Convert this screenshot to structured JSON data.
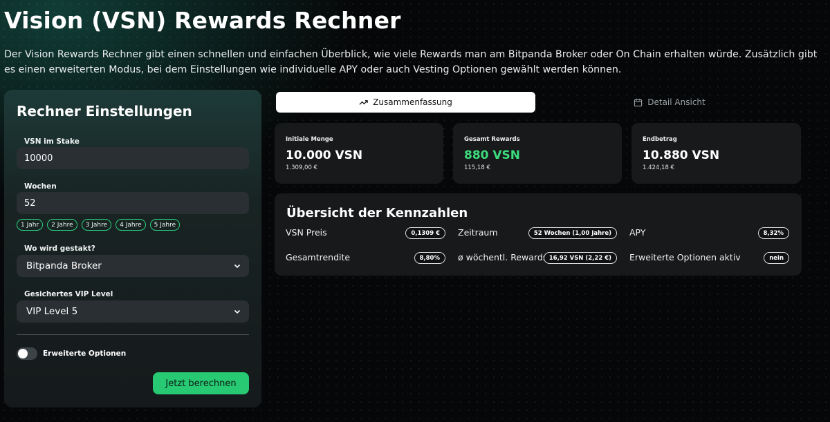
{
  "page": {
    "title": "Vision (VSN) Rewards Rechner",
    "description": "Der Vision Rewards Rechner gibt einen schnellen und einfachen Überblick, wie viele Rewards man am Bitpanda Broker oder On Chain erhalten würde. Zusätzlich gibt es einen erweiterten Modus, bei dem Einstellungen wie individuelle APY oder auch Vesting Optionen gewählt werden können."
  },
  "settings": {
    "title": "Rechner Einstellungen",
    "stake_label": "VSN im Stake",
    "stake_value": "10000",
    "weeks_label": "Wochen",
    "weeks_value": "52",
    "week_chips": [
      "1 Jahr",
      "2 Jahre",
      "3 Jahre",
      "4 Jahre",
      "5 Jahre"
    ],
    "location_label": "Wo wird gestakt?",
    "location_value": "Bitpanda Broker",
    "vip_label": "Gesichertes VIP Level",
    "vip_value": "VIP Level 5",
    "advanced_label": "Erweiterte Optionen",
    "calc_button": "Jetzt berechnen"
  },
  "tabs": {
    "summary": "Zusammenfassung",
    "detail": "Detail Ansicht"
  },
  "stats": {
    "initial": {
      "label": "Initiale Menge",
      "value": "10.000 VSN",
      "sub": "1.309,00 €"
    },
    "rewards": {
      "label": "Gesamt Rewards",
      "value": "880 VSN",
      "sub": "115,18 €"
    },
    "final": {
      "label": "Endbetrag",
      "value": "10.880 VSN",
      "sub": "1.424,18 €"
    }
  },
  "overview": {
    "title": "Übersicht der Kennzahlen",
    "metrics": [
      {
        "label": "VSN Preis",
        "value": "0,1309 €"
      },
      {
        "label": "Zeitraum",
        "value": "52 Wochen (1,00 Jahre)"
      },
      {
        "label": "APY",
        "value": "8,32%"
      },
      {
        "label": "Gesamtrendite",
        "value": "8,80%"
      },
      {
        "label": "ø wöchentl. Rewards",
        "value": "16,92 VSN (2,22 €)"
      },
      {
        "label": "Erweiterte Optionen aktiv",
        "value": "nein"
      }
    ]
  },
  "colors": {
    "accent_green": "#27c973",
    "rewards_green": "#3ddc7c",
    "panel_bg": "#17191b",
    "page_bg": "#060708"
  },
  "icons": {
    "summary_tab": "trending-up-icon",
    "detail_tab": "calendar-icon",
    "select": "chevron-down-icon"
  }
}
